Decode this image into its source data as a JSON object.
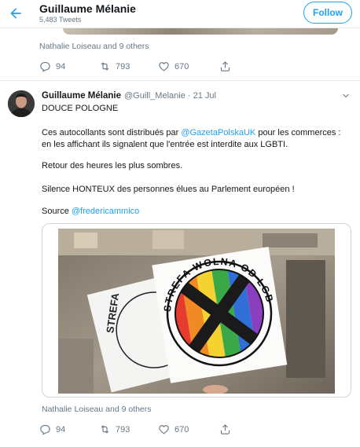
{
  "header": {
    "name": "Guillaume Mélanie",
    "tweet_count": "5,483 Tweets",
    "follow_label": "Follow"
  },
  "previous_tweet": {
    "liked_by": "Nathalie Loiseau and 9 others",
    "replies": "94",
    "retweets": "793",
    "likes": "670"
  },
  "tweet": {
    "name": "Guillaume Mélanie",
    "handle": "@Guill_Melanie",
    "separator": "·",
    "date": "21 Jul",
    "line1": "DOUCE POLOGNE",
    "line2_pre": "Ces autocollants sont distribués par ",
    "line2_mention": "@GazetaPolskaUK",
    "line2_post": " pour les commerces :",
    "line3": "en les affichant ils signalent que l'entrée est interdite aux LGBTI.",
    "line4": "Retour des heures les plus sombres.",
    "line5": "Silence HONTEUX des personnes élues au Parlement européen !",
    "line6_pre": "Source ",
    "line6_mention": "@fredericammico",
    "sticker_text": "STREFA WOLNA OD LGBT",
    "sticker_text_back": "STREFA",
    "liked_by": "Nathalie Loiseau and 9 others",
    "replies": "94",
    "retweets": "793",
    "likes": "670"
  },
  "colors": {
    "accent": "#1da1f2",
    "secondary_text": "#657786",
    "border": "#e6ecf0"
  },
  "icons": [
    "back-arrow-icon",
    "reply-icon",
    "retweet-icon",
    "like-icon",
    "share-icon",
    "chevron-down-icon"
  ]
}
